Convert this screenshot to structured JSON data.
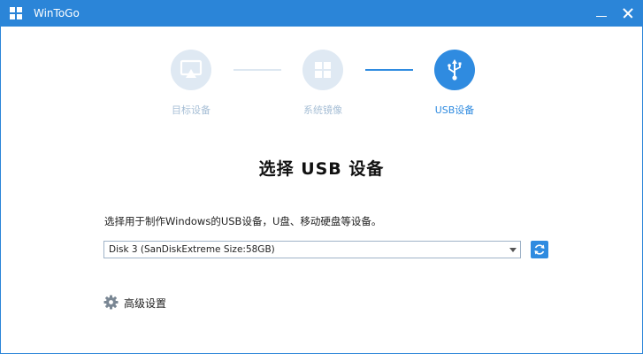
{
  "window": {
    "title": "WinToGo",
    "app_icon": "windows-logo-icon",
    "accent": "#2b85d8"
  },
  "steps": [
    {
      "label": "目标设备",
      "icon": "monitor-icon",
      "state": "inactive"
    },
    {
      "label": "系统镜像",
      "icon": "windows-logo-icon",
      "state": "inactive"
    },
    {
      "label": "USB设备",
      "icon": "usb-icon",
      "state": "active"
    }
  ],
  "main": {
    "title": "选择 USB 设备",
    "instruction": "选择用于制作Windows的USB设备，U盘、移动硬盘等设备。",
    "disk_select": {
      "value": "Disk 3 (SanDiskExtreme Size:58GB)"
    },
    "refresh_icon": "refresh-icon"
  },
  "advanced": {
    "label": "高级设置",
    "icon": "gear-icon"
  },
  "colors": {
    "active": "#2f8be0",
    "inactive_circle": "#dfe9f3",
    "inactive_text": "#a7bfd6"
  }
}
